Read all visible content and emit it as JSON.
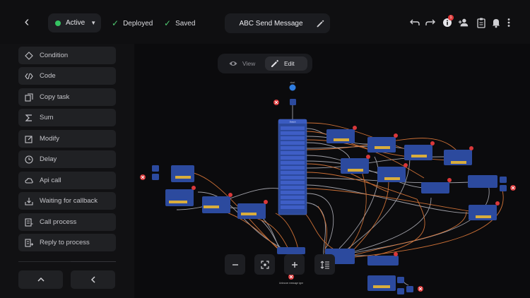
{
  "header": {
    "status_label": "Active",
    "deployed_label": "Deployed",
    "saved_label": "Saved",
    "title": "ABC Send Message",
    "notification_count": "1"
  },
  "sidebar": {
    "items": [
      {
        "label": "Condition",
        "icon": "diamond-icon"
      },
      {
        "label": "Code",
        "icon": "code-icon"
      },
      {
        "label": "Copy task",
        "icon": "copy-icon"
      },
      {
        "label": "Sum",
        "icon": "sigma-icon"
      },
      {
        "label": "Modify",
        "icon": "edit-box-icon"
      },
      {
        "label": "Delay",
        "icon": "clock-icon"
      },
      {
        "label": "Api call",
        "icon": "cloud-icon"
      },
      {
        "label": "Waiting for callback",
        "icon": "download-tray-icon"
      },
      {
        "label": "Call process",
        "icon": "process-icon"
      },
      {
        "label": "Reply to process",
        "icon": "reply-process-icon"
      }
    ]
  },
  "canvas": {
    "view_label": "View",
    "edit_label": "Edit",
    "node_labels": {
      "start": "start",
      "switch_header": "Switch",
      "notice": "Unknown message type"
    }
  },
  "colors": {
    "accent_green": "#35c462",
    "node_blue": "#2c4a9e",
    "node_header": "#3a5bc0",
    "node_button": "#d9ad3c",
    "edge_orange": "#e07a3a",
    "edge_grey": "#b8b8c0",
    "error_red": "#d9383a"
  }
}
